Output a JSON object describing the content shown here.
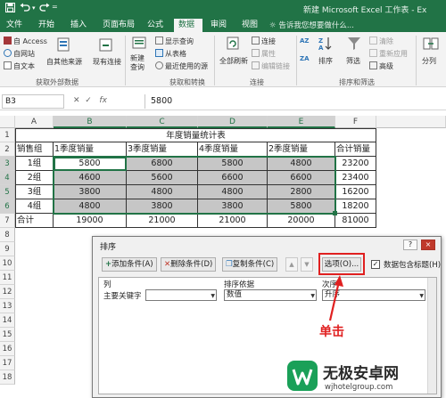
{
  "titlebar": {
    "title": "新建 Microsoft Excel 工作表 - Ex",
    "save_icon": "save-icon",
    "undo_icon": "undo-icon",
    "redo_icon": "redo-icon",
    "brand_color": "#217346"
  },
  "menu": {
    "tabs": [
      "文件",
      "开始",
      "插入",
      "页面布局",
      "公式",
      "数据",
      "审阅",
      "视图"
    ],
    "active_tab": "数据",
    "tell_me": "告诉我您想要做什么..."
  },
  "ribbon": {
    "get_external": {
      "items": [
        "自 Access",
        "自网站",
        "自文本",
        "自其他来源",
        "现有连接"
      ],
      "group_label": "获取外部数据"
    },
    "get_transform": {
      "new_query": "新建\n查询",
      "items": [
        "显示查询",
        "从表格",
        "最近使用的源"
      ],
      "group_label": "获取和转换"
    },
    "connections": {
      "refresh_all": "全部刷新",
      "items": [
        "连接",
        "属性",
        "编辑链接"
      ],
      "group_label": "连接"
    },
    "sort_filter": {
      "sort_az": "AZ",
      "sort_za": "ZA",
      "sort": "排序",
      "filter": "筛选",
      "items": [
        "清除",
        "重新应用",
        "高级"
      ],
      "group_label": "排序和筛选"
    },
    "text_to_columns": "分列"
  },
  "formula_bar": {
    "name_box": "B3",
    "fx": "fx",
    "value": "5800"
  },
  "sheet": {
    "col_headers": [
      "A",
      "B",
      "C",
      "D",
      "E",
      "F"
    ],
    "selected_cols": [
      "B",
      "C",
      "D",
      "E"
    ],
    "row_headers": [
      "1",
      "2",
      "3",
      "4",
      "5",
      "6",
      "7",
      "8",
      "9",
      "10",
      "11",
      "12",
      "13",
      "14",
      "15",
      "16",
      "17",
      "18"
    ],
    "selected_rows": [
      "3",
      "4",
      "5",
      "6"
    ],
    "title": "年度销量统计表",
    "header_row": [
      "销售组",
      "1季度销量",
      "3季度销量",
      "4季度销量",
      "2季度销量",
      "合计销量"
    ],
    "rows": [
      [
        "1组",
        "5800",
        "6800",
        "5800",
        "4800",
        "23200"
      ],
      [
        "2组",
        "4600",
        "5600",
        "6600",
        "6600",
        "23400"
      ],
      [
        "3组",
        "3800",
        "4800",
        "4800",
        "2800",
        "16200"
      ],
      [
        "4组",
        "4800",
        "3800",
        "3800",
        "5800",
        "18200"
      ]
    ],
    "total_row": [
      "合计",
      "19000",
      "21000",
      "21000",
      "20000",
      "81000"
    ]
  },
  "sort_dialog": {
    "title": "排序",
    "help": "?",
    "close": "×",
    "add_level": "添加条件(A)",
    "delete_level": "删除条件(D)",
    "copy_level": "复制条件(C)",
    "move_up": "▲",
    "move_down": "▼",
    "options": "选项(O)...",
    "has_headers_label": "数据包含标题(H)",
    "has_headers_checked": "✓",
    "col_header": "列",
    "sort_on_header": "排序依据",
    "order_header": "次序",
    "row_label": "主要关键字",
    "row_sort_on": "数值",
    "row_order": "升序",
    "highlight_color": "#e02020"
  },
  "annotation": {
    "text": "单击"
  },
  "watermark": {
    "name": "无极安卓网",
    "url": "wjhotelgroup.com"
  }
}
